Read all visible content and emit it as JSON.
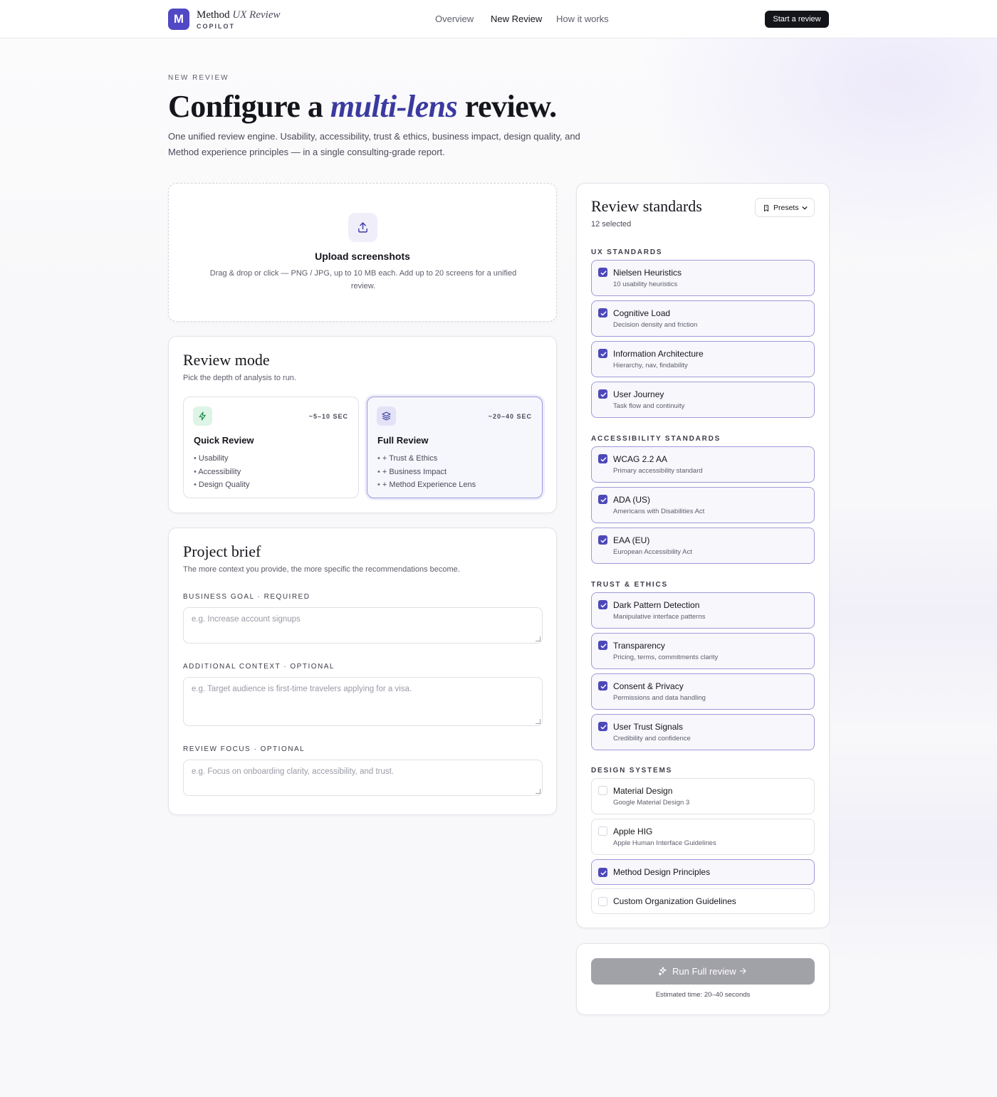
{
  "header": {
    "brand_name": "Method",
    "brand_name_italic": "UX Review",
    "brand_sub": "COPILOT",
    "logo_letter": "M",
    "nav": [
      "Overview",
      "New Review",
      "How it works"
    ],
    "active_nav": "New Review",
    "cta": "Start a review"
  },
  "hero": {
    "eyebrow": "NEW REVIEW",
    "title_before": "Configure a",
    "title_italic": "multi-lens",
    "title_after": "review.",
    "description": "One unified review engine. Usability, accessibility, trust & ethics, business impact, design quality, and Method experience principles — in a single consulting-grade report."
  },
  "upload": {
    "icon": "upload-icon",
    "title": "Upload screenshots",
    "description": "Drag & drop or click — PNG / JPG, up to 10 MB each. Add up to 20 screens for a unified review."
  },
  "review_mode": {
    "title": "Review mode",
    "subtitle": "Pick the depth of analysis to run.",
    "options": [
      {
        "name": "Quick Review",
        "time": "~5–10 SEC",
        "icon": "lightning-icon",
        "selected": false,
        "items": [
          "Usability",
          "Accessibility",
          "Design Quality"
        ]
      },
      {
        "name": "Full Review",
        "time": "~20–40 SEC",
        "icon": "layers-icon",
        "selected": true,
        "items": [
          "+ Trust & Ethics",
          "+ Business Impact",
          "+ Method Experience Lens"
        ]
      }
    ]
  },
  "project_brief": {
    "title": "Project brief",
    "subtitle": "The more context you provide, the more specific the recommendations become.",
    "fields": [
      {
        "label": "BUSINESS GOAL · REQUIRED",
        "placeholder": "e.g. Increase account signups",
        "value": ""
      },
      {
        "label": "ADDITIONAL CONTEXT · OPTIONAL",
        "placeholder": "e.g. Target audience is first-time travelers applying for a visa.",
        "value": ""
      },
      {
        "label": "REVIEW FOCUS · OPTIONAL",
        "placeholder": "e.g. Focus on onboarding clarity, accessibility, and trust.",
        "value": ""
      }
    ]
  },
  "standards": {
    "title": "Review standards",
    "count": "12 selected",
    "presets_label": "Presets",
    "groups": [
      {
        "label": "UX STANDARDS",
        "items": [
          {
            "name": "Nielsen Heuristics",
            "desc": "10 usability heuristics",
            "checked": true
          },
          {
            "name": "Cognitive Load",
            "desc": "Decision density and friction",
            "checked": true
          },
          {
            "name": "Information Architecture",
            "desc": "Hierarchy, nav, findability",
            "checked": true
          },
          {
            "name": "User Journey",
            "desc": "Task flow and continuity",
            "checked": true
          }
        ]
      },
      {
        "label": "ACCESSIBILITY STANDARDS",
        "items": [
          {
            "name": "WCAG 2.2 AA",
            "desc": "Primary accessibility standard",
            "checked": true
          },
          {
            "name": "ADA (US)",
            "desc": "Americans with Disabilities Act",
            "checked": true
          },
          {
            "name": "EAA (EU)",
            "desc": "European Accessibility Act",
            "checked": true
          }
        ]
      },
      {
        "label": "TRUST & ETHICS",
        "items": [
          {
            "name": "Dark Pattern Detection",
            "desc": "Manipulative interface patterns",
            "checked": true
          },
          {
            "name": "Transparency",
            "desc": "Pricing, terms, commitments clarity",
            "checked": true
          },
          {
            "name": "Consent & Privacy",
            "desc": "Permissions and data handling",
            "checked": true
          },
          {
            "name": "User Trust Signals",
            "desc": "Credibility and confidence",
            "checked": true
          }
        ]
      },
      {
        "label": "DESIGN SYSTEMS",
        "items": [
          {
            "name": "Material Design",
            "desc": "Google Material Design 3",
            "checked": false
          },
          {
            "name": "Apple HIG",
            "desc": "Apple Human Interface Guidelines",
            "checked": false
          },
          {
            "name": "Method Design Principles",
            "desc": "",
            "checked": true
          },
          {
            "name": "Custom Organization Guidelines",
            "desc": "",
            "checked": false
          }
        ]
      }
    ]
  },
  "run": {
    "button": "Run Full review",
    "estimate": "Estimated time: 20–40 seconds"
  },
  "colors": {
    "accent": "#4d48b8",
    "logo": "#5048c4",
    "hero_italic": "#3b3aa0",
    "cta_dark": "#14151b",
    "run_disabled": "#a1a1a8"
  }
}
